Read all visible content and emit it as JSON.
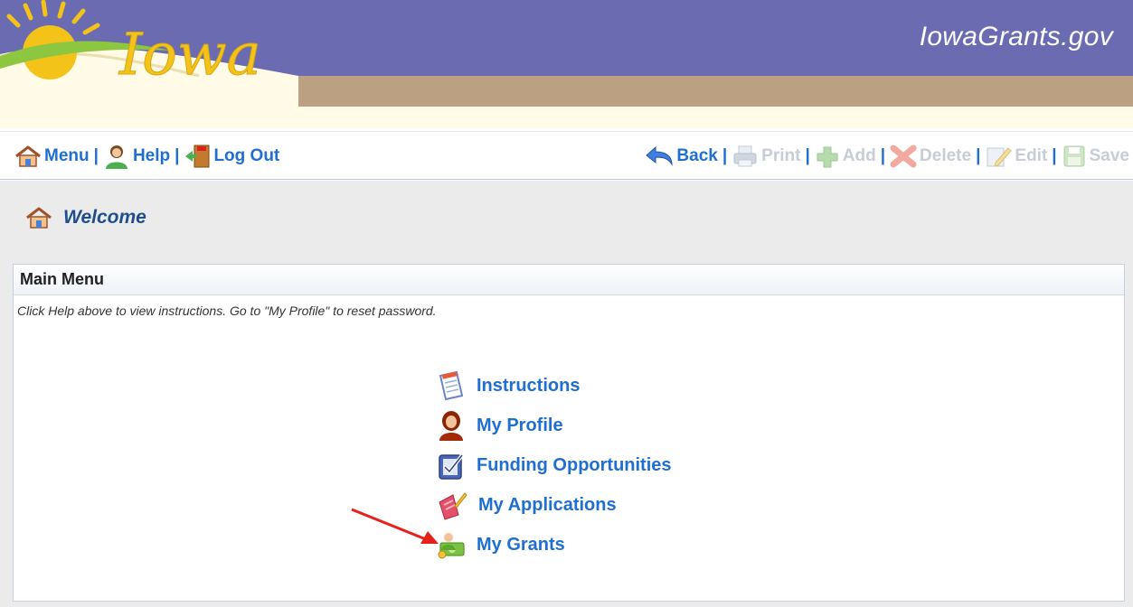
{
  "header": {
    "logo_text": "Iowa",
    "site_title": "IowaGrants.gov"
  },
  "toolbar": {
    "left": [
      {
        "label": "Menu",
        "icon": "house-icon"
      },
      {
        "label": "Help",
        "icon": "person-help-icon"
      },
      {
        "label": "Log Out",
        "icon": "exit-door-icon"
      }
    ],
    "right": [
      {
        "label": "Back",
        "icon": "back-arrow-icon",
        "enabled": true
      },
      {
        "label": "Print",
        "icon": "printer-icon",
        "enabled": false
      },
      {
        "label": "Add",
        "icon": "add-plus-icon",
        "enabled": false
      },
      {
        "label": "Delete",
        "icon": "delete-x-icon",
        "enabled": false
      },
      {
        "label": "Edit",
        "icon": "edit-pencil-icon",
        "enabled": false
      },
      {
        "label": "Save",
        "icon": "save-disk-icon",
        "enabled": false
      }
    ]
  },
  "page": {
    "title": "Welcome",
    "title_icon": "house-icon"
  },
  "main_menu": {
    "title": "Main Menu",
    "note": "Click Help above to view instructions. Go to \"My Profile\" to reset password.",
    "items": [
      {
        "label": "Instructions",
        "icon": "document-icon"
      },
      {
        "label": "My Profile",
        "icon": "user-profile-icon"
      },
      {
        "label": "Funding Opportunities",
        "icon": "clipboard-check-icon"
      },
      {
        "label": "My Applications",
        "icon": "application-brush-icon"
      },
      {
        "label": "My Grants",
        "icon": "grants-money-icon"
      }
    ]
  },
  "colors": {
    "banner_purple": "#6a6bb1",
    "banner_tan": "#bba082",
    "link_blue": "#1f6fd1",
    "heading_navy": "#1e4e8c",
    "arrow_red": "#e8201c"
  }
}
